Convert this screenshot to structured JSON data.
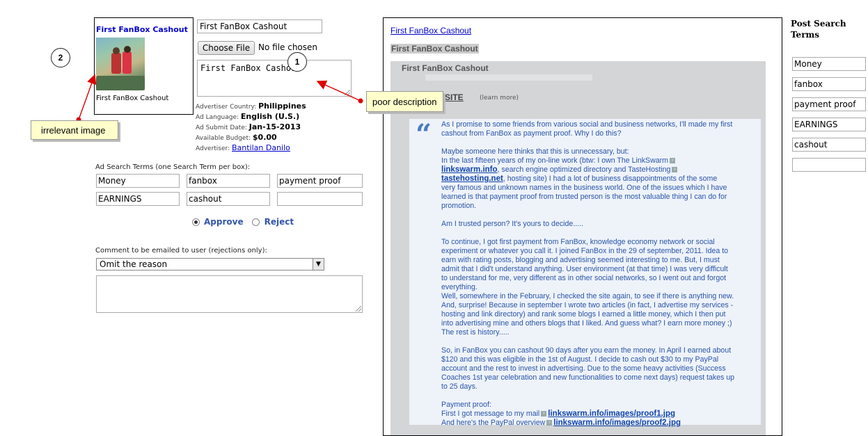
{
  "ad": {
    "preview_title": "First FanBox Cashout",
    "preview_caption": "First FanBox Cashout",
    "title_value": "First FanBox Cashout",
    "file_button": "Choose File",
    "file_status": "No file chosen",
    "description_value": "First FanBox Cashout",
    "meta": {
      "country_label": "Advertiser Country:",
      "country_value": "Philippines",
      "language_label": "Ad Language:",
      "language_value": "English (U.S.)",
      "submit_label": "Ad Submit Date:",
      "submit_value": "Jan-15-2013",
      "budget_label": "Available Budget:",
      "budget_value": "$0.00",
      "advertiser_label": "Advertiser:",
      "advertiser_value": "Bantilan Danilo"
    },
    "terms_label": "Ad Search Terms (one Search Term per box):",
    "terms": [
      "Money",
      "fanbox",
      "payment proof",
      "EARNINGS",
      "cashout",
      ""
    ],
    "approve_label": "Approve",
    "reject_label": "Reject",
    "selected_action": "Approve",
    "comment_label": "Comment to be emailed to user (rejections only):",
    "comment_reason": "Omit the reason",
    "comment_text": ""
  },
  "annotations": {
    "one": "1",
    "two": "2",
    "poor_description": "poor description",
    "irrelevant_image": "irrelevant image",
    "arrow_color": "#dd0000"
  },
  "preview": {
    "link": "First FanBox Cashout",
    "heading": "First FanBox Cashout",
    "card_title": "First FanBox Cashout",
    "site_link": "SITE",
    "learn_more": "(learn more)",
    "story": {
      "p1_l1": "As I promise to some friends from various social and business networks, I'll made my first",
      "p1_l2": "cashout from FanBox as payment proof. Why I do this?",
      "p2_l1": "Maybe someone here thinks that this is unnecessary, but:",
      "p2_l2": "In the last fifteen years of my on-line work (btw: I own The LinkSwarm",
      "p2_link1": "linkswarm.info",
      "p2_l3": ", search engine optimized directory and TasteHosting",
      "p2_link2": "tastehosting.net",
      "p2_l4": ", hosting site) I had a lot of business disappointments of the some",
      "p2_l5": "very famous and unknown names in the business world. One of the issues which I have",
      "p2_l6": "learned is that payment proof from trusted person is the most valuable thing I can do for",
      "p2_l7": "promotion.",
      "p3": "Am I trusted person? It's yours to decide.....",
      "p4_l1": "To continue, I got first payment from FanBox, knowledge economy network or social",
      "p4_l2": "experiment or whatever you call it. I joined FanBox in the 29 of september, 2011. Idea to",
      "p4_l3": "earn with rating posts, blogging and advertising seemed interesting to me. But, I must",
      "p4_l4": "admit that I did't understand anything. User environment (at that time) I was very difficult",
      "p4_l5": "to understand for me, very different as in other social networks, so I went out and forgot",
      "p4_l6": "everything.",
      "p4_l7": "Well, somewhere in the February, I checked the site again, to see if there is anything new.",
      "p4_l8": "And, surprise! Because in september I wrote two articles (in fact, I advertise my services -",
      "p4_l9": "hosting and link directory) and rank some blogs I earned a little money, which I then put",
      "p4_l10": "into advertising mine and others blogs that I liked. And guess what? I earn more money ;)",
      "p4_l11": "The rest is history.....",
      "p5_l1": "So, in FanBox you can cashout 90 days after you earn the money. In April I earned about",
      "p5_l2": "$120 and this was eligible in the 1st of August. I decide to cash out $30 to my PayPal",
      "p5_l3": "account and the rest to invest in advertising. Due to the some heavy activities (Success",
      "p5_l4": "Coaches 1st year celebration and new functionalities to come next days) request takes up",
      "p5_l5": "to 25 days.",
      "p6_l1": "Payment proof:",
      "p6_l2": "First I got message to my mail",
      "p6_link1": "linkswarm.info/images/proof1.jpg",
      "p6_l3": "And here's the PayPal overview",
      "p6_link2": "linkswarm.info/images/proof2.jpg"
    }
  },
  "post_search": {
    "title": "Post Search Terms",
    "terms": [
      "Money",
      "fanbox",
      "payment proof",
      "EARNINGS",
      "cashout",
      ""
    ]
  }
}
